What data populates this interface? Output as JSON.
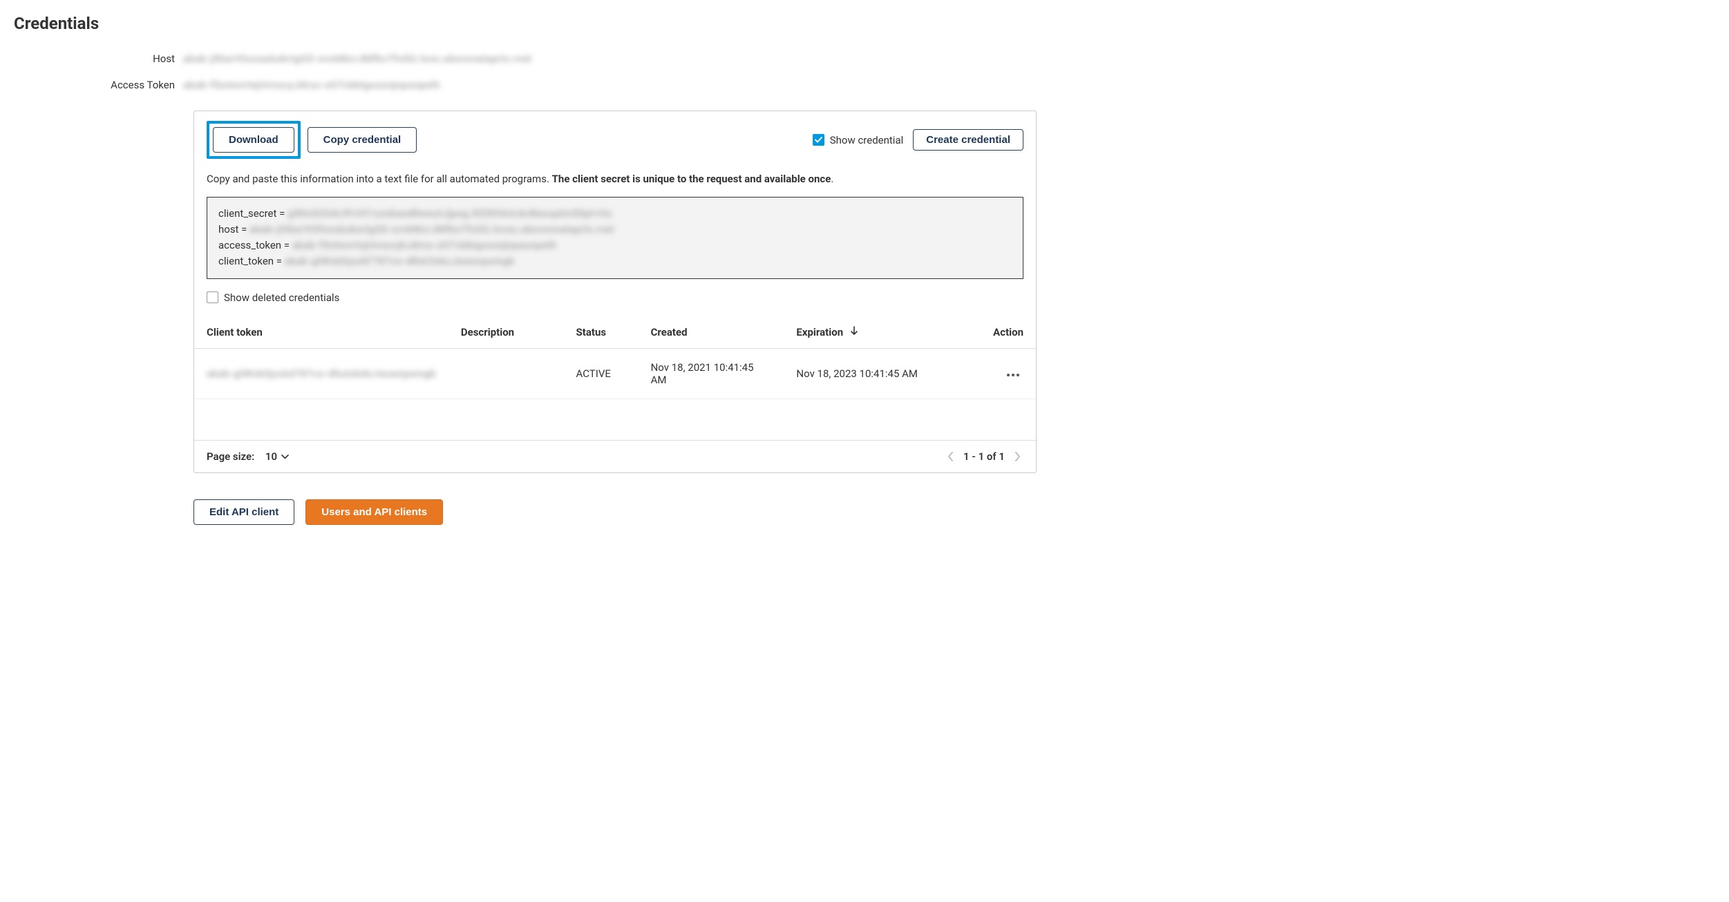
{
  "page": {
    "title": "Credentials"
  },
  "fields": {
    "host_label": "Host",
    "host_value": "akab-jXbxrVtsssaAokrIgSS-svvbNcrJMfkv7fsSG.lxvo.ubxvsvaIaprIs.rvet",
    "token_label": "Access Token",
    "token_value": "akab-fSuIwvrtejrIrnscyJdrss-stI7cbbIgsssnjopsnpeIh"
  },
  "toolbar": {
    "download_label": "Download",
    "copy_label": "Copy credential",
    "show_credential_label": "Show credential",
    "show_credential_checked": true,
    "create_label": "Create credential"
  },
  "info": {
    "plain": "Copy and paste this information into a text file for all automated programs. ",
    "bold": "The client secret is unique to the request and available once"
  },
  "code": {
    "client_secret_key": "client_secret = ",
    "client_secret_val": "gWtxSOUA/IFvVI1sxxbxedRewotJjpsg.lllZ89AUvAvBasspImSlIpI+Ox",
    "host_key": "host = ",
    "host_val": "akab-jIXbxrVttfsssbokxrIgSS-svvbNcrJMfkx7fsSG.lxvxo.ubxvsvnaIaprIs.rvet",
    "access_token_key": "access_token = ",
    "access_token_val": "akab-fSnlwvrtsjrIrnscybJdrss-stI7cbbIgssxnjnpasnpeIh",
    "client_token_key": "client_token = ",
    "client_token_val": "akab-gIWsbQyxAF787co-dRet3xbcJweonpxmgb"
  },
  "show_deleted_label": "Show deleted credentials",
  "table": {
    "headers": {
      "client_token": "Client token",
      "description": "Description",
      "status": "Status",
      "created": "Created",
      "expiration": "Expiration",
      "action": "Action"
    },
    "rows": [
      {
        "client_token": "akab-gIWsbQyxAd787co-dhutxbdxJwoenpxmgb",
        "description": "",
        "status": "ACTIVE",
        "created": "Nov 18, 2021 10:41:45 AM",
        "expiration": "Nov 18, 2023 10:41:45 AM"
      }
    ]
  },
  "pagination": {
    "page_size_label": "Page size:",
    "page_size_value": "10",
    "range": "1 - 1 of 1"
  },
  "bottom": {
    "edit_label": "Edit API client",
    "users_label": "Users and API clients"
  }
}
